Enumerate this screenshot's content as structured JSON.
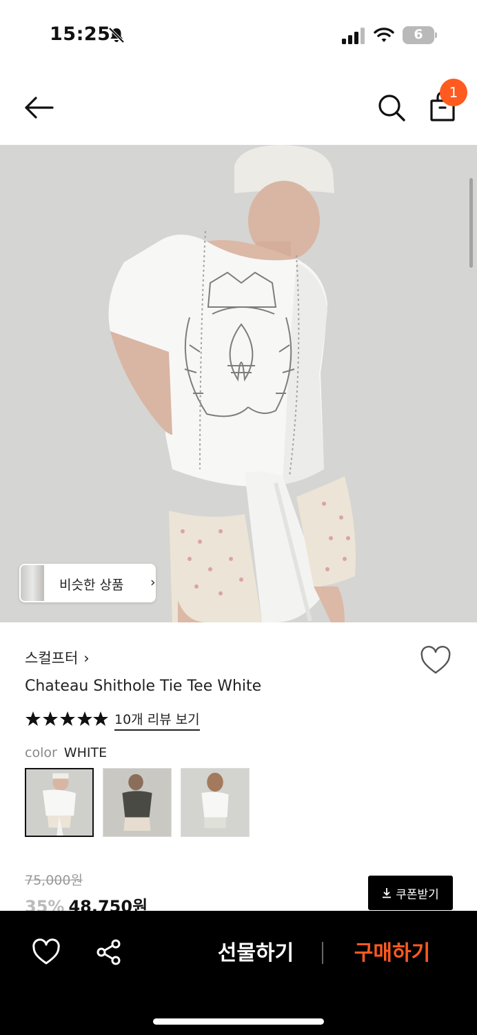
{
  "status_bar": {
    "time": "15:25",
    "battery": "6",
    "icons": [
      "bell-off-icon",
      "cellular-signal-icon",
      "wifi-icon",
      "battery-icon"
    ]
  },
  "header": {
    "icons": [
      "back-arrow-icon",
      "search-icon",
      "shopping-bag-icon"
    ],
    "cart_count": "1"
  },
  "hero": {
    "similar_label": "비슷한 상품",
    "similar_chevron": "›"
  },
  "product": {
    "brand": "스컬프터",
    "brand_chevron": "›",
    "title": "Chateau Shithole Tie Tee White",
    "rating": 5,
    "review_link": "10개 리뷰 보기",
    "color_label": "color",
    "color_value": "WHITE",
    "swatches": [
      "white",
      "charcoal",
      "white-alt"
    ],
    "selected_swatch": 0,
    "original_price": "75,000원",
    "discount": "35%",
    "price": "48,750원",
    "coupon_label": "쿠폰받기"
  },
  "bottom_bar": {
    "gift_label": "선물하기",
    "buy_label": "구매하기",
    "buy_color": "#ff5a1f"
  },
  "colors": {
    "accent": "#ff5a1f",
    "bottom_bar_bg": "#000000"
  }
}
